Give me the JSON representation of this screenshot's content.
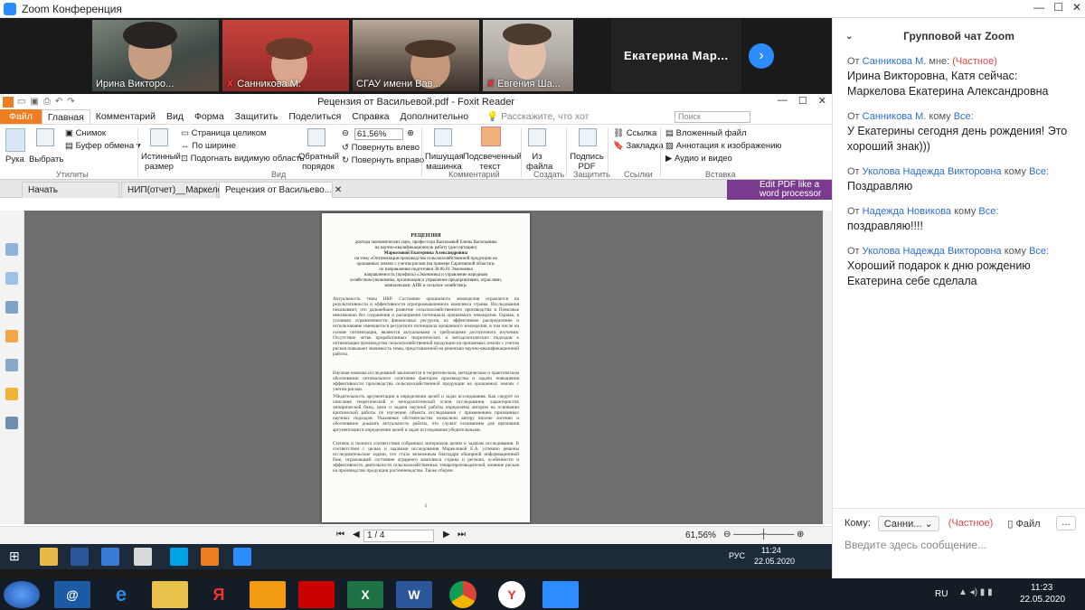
{
  "zoom": {
    "title": "Zoom Конференция",
    "participants": [
      {
        "name": "Ирина Викторо...",
        "muted": false
      },
      {
        "name": "Санникова М.",
        "muted": true
      },
      {
        "name": "СГАУ имени Вав...",
        "muted": false
      },
      {
        "name": "Евгения Ша...",
        "muted": true
      },
      {
        "name": "Екатерина  Мар...",
        "muted": false
      }
    ]
  },
  "chat": {
    "title": "Групповой чат Zoom",
    "messages": [
      {
        "from": "От",
        "sender": "Санникова М.",
        "to_word": "мне:",
        "target": "",
        "private": "(Частное)",
        "text": "Ирина Викторовна, Катя сейчас: Маркелова Екатерина Александровна"
      },
      {
        "from": "От",
        "sender": "Санникова М.",
        "to_word": "кому",
        "target": "Все:",
        "private": "",
        "text": "У Екатерины сегодня день рождения! Это хороший знак)))"
      },
      {
        "from": "От",
        "sender": "Уколова Надежда Викторовна",
        "to_word": "кому",
        "target": "Все:",
        "private": "",
        "text": "Поздравляю"
      },
      {
        "from": "От",
        "sender": "Надежда Новикова",
        "to_word": "кому",
        "target": "Все:",
        "private": "",
        "text": "поздравляю!!!!"
      },
      {
        "from": "От",
        "sender": "Уколова Надежда Викторовна",
        "to_word": "кому",
        "target": "Все:",
        "private": "",
        "text": "Хороший подарок к дню рождению Екатерина себе сделала"
      }
    ],
    "to_label": "Кому:",
    "to_value": "Санни...",
    "private_label": "(Частное)",
    "file_label": "Файл",
    "more_label": "...",
    "input_placeholder": "Введите здесь сообщение..."
  },
  "foxit": {
    "window_title": "Рецензия от Васильевой.pdf - Foxit Reader",
    "menu": [
      "Файл",
      "Главная",
      "Комментарий",
      "Вид",
      "Форма",
      "Защитить",
      "Поделиться",
      "Справка",
      "Дополнительно"
    ],
    "tell_me": "Расскажите, что хот",
    "search_placeholder": "Поиск",
    "ribbon": {
      "hand": "Рука",
      "select": "Выбрать",
      "snapshot": "Снимок",
      "clipboard": "Буфер обмена",
      "utilities": "Утилиты",
      "actual_size": "Истинный размер",
      "fit_page": "Страница целиком",
      "fit_width": "По ширине",
      "fit_visible": "Подогнать видимую область",
      "reflow": "Обратный порядок",
      "view_group": "Вид",
      "zoom": "61,56%",
      "rotate_left": "Повернуть влево",
      "rotate_right": "Повернуть вправо",
      "typewriter": "Пишущая машинка",
      "highlight": "Подсвеченный текст",
      "comment_group": "Комментарий",
      "from_file": "Из файла",
      "create_group": "Создать",
      "sign_pdf": "Подпись PDF",
      "protect_group": "Защитить",
      "link": "Ссылка",
      "bookmark": "Закладка",
      "links_group": "Ссылки",
      "attached_file": "Вложенный файл",
      "image_annotation": "Аннотация к изображению",
      "audio_video": "Аудио и видео",
      "insert_group": "Вставка"
    },
    "tabs": [
      "Начать",
      "НИП(отчет)__Маркело...",
      "Рецензия от Васильево..."
    ],
    "edit_pdf_ad": "Edit PDF like a word processor",
    "page_indicator": "1 / 4",
    "zoom_status": "61,56%"
  },
  "document": {
    "heading": "РЕЦЕНЗИЯ",
    "lines": [
      "доктора экономических наук, профессора Васильевой Елены Васильевны",
      "на научно-квалификационную работу (диссертацию)",
      "Маркеловой Екатерины Александровны",
      "на тему «Оптимизация производства сельскохозяйственной продукции на",
      "орошаемых землях с учетом рисков (на примере Саратовской области)»",
      "по направлению подготовки 38.06.01 Экономика",
      "направленность (профиль) «Экономика и управление народным",
      "хозяйством (экономика, организация и управление предприятиями, отраслями,",
      "комплексами: АПК и сельское хозяйство)»"
    ],
    "para1": "Актуальность темы НКР. Состояние орошаемого земледелия отражается на результативности и эффективности агропромышленного комплекса страны. Исследования показывают, что дальнейшее развитие сельскохозяйственного производства в Поволжье невозможно без сохранения и расширения потенциала орошаемого земледелия. Однако, в условиях ограниченности финансовых ресурсов, их эффективное распределение и использование имеющегося ресурсного потенциала орошаемого земледелия, в том числе на основе оптимизации, являются актуальными и требующими достаточного изучения. Отсутствие четко проработанных теоретических и методологических подходов к оптимизации производства сельскохозяйственной продукции на орошаемых землях с учетом рисков повышает значимость темы, представленной на рецензию научно-квалификационной работы.",
    "para2": "Научная новизна исследований заключается в теоретическом, методическом и практическом обосновании оптимального сочетания факторов производства и задачи повышения эффективности производства сельскохозяйственной продукции на орошаемых землях с учетом рисков.",
    "para3": "Убедительность аргументации в определении целей и задач исследования. Как следует из описания теоретической и методологической основ исследования, характеристик эмпирической базы, цели и задачи научной работы определены автором на основании критической работы по изучению объекта исследования с применением признанных научных подходов. Указанные обстоятельства позволили автору вполне логично и обоснованно доказать актуальность работы, что служит основанием для признания аргументации в определении целей и задач исследования убедительными.",
    "para4": "Степень и полнота соответствия собранных материалов целям и задачам исследования. В соответствии с целью и задачами исследования Маркеловой Е.А. успешно решены исследовательские задачи, что стало возможным благодаря обширной информационной базе, отражающей состояние аграрного комплекса страны и региона, особенности и эффективность деятельности сельскохозяйственных товаропроизводителей, влияние рисков на производство продукции растениеводства. Также сбором",
    "page_number": "1"
  },
  "inner_taskbar": {
    "lang": "РУС",
    "time": "11:24",
    "date": "22.05.2020"
  },
  "taskbar": {
    "lang": "RU",
    "time": "11:23",
    "date": "22.05.2020"
  }
}
